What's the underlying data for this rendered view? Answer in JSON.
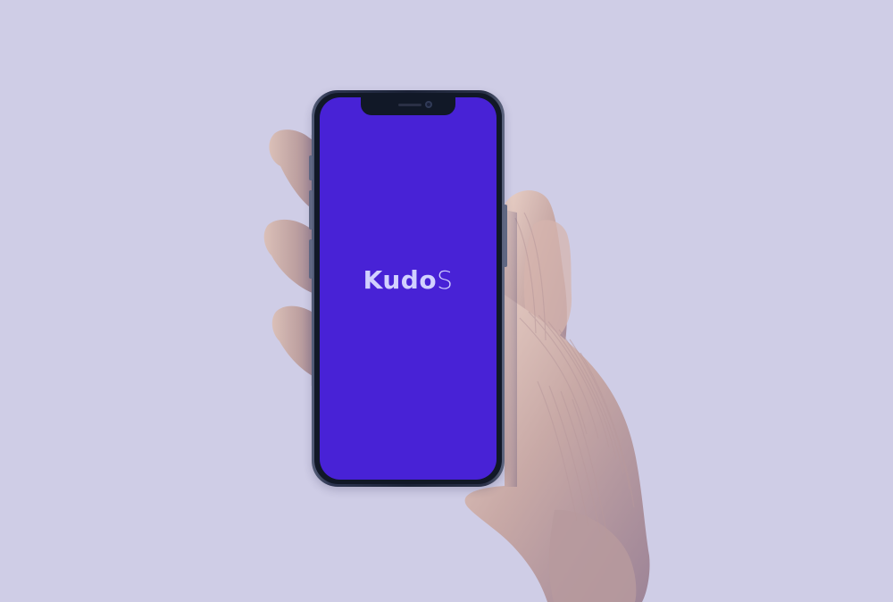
{
  "screen": {
    "logo": {
      "main": "Kudo",
      "suffix": "S"
    },
    "background_color": "#4822d6",
    "logo_color": "#d2d1ff"
  },
  "scene": {
    "background_color": "#cfcde6"
  },
  "icons": {
    "camera": "camera-icon",
    "speaker": "speaker-icon"
  }
}
